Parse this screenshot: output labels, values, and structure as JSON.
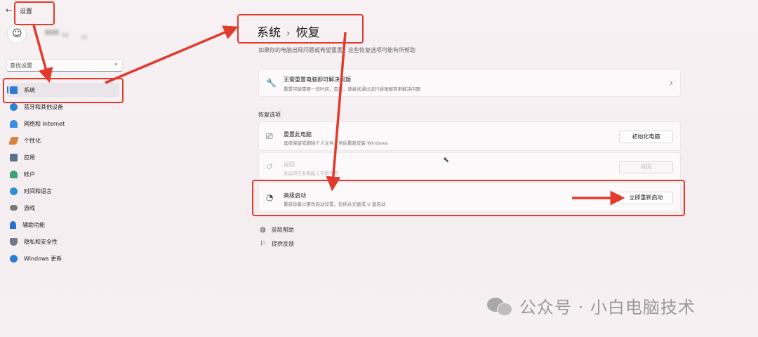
{
  "app": {
    "back_glyph": "←",
    "title": "设置"
  },
  "user": {
    "avatar": "smiley-avatar"
  },
  "search": {
    "placeholder": "查找设置",
    "icon": "search-icon"
  },
  "sidebar": {
    "items": [
      {
        "label": "系统",
        "icon": "display-icon",
        "color": "#2f7bd6",
        "active": true
      },
      {
        "label": "蓝牙和其他设备",
        "icon": "bluetooth-icon",
        "color": "#2c82d9"
      },
      {
        "label": "网络和 Internet",
        "icon": "wifi-icon",
        "color": "#3a8ee6"
      },
      {
        "label": "个性化",
        "icon": "brush-icon",
        "color": "#d9823a"
      },
      {
        "label": "应用",
        "icon": "apps-icon",
        "color": "#5a6f8a"
      },
      {
        "label": "帐户",
        "icon": "account-icon",
        "color": "#3aa37a"
      },
      {
        "label": "时间和语言",
        "icon": "globe-clock-icon",
        "color": "#2e8fd0"
      },
      {
        "label": "游戏",
        "icon": "gamepad-icon",
        "color": "#7a7a7a"
      },
      {
        "label": "辅助功能",
        "icon": "accessibility-icon",
        "color": "#2b6fd0"
      },
      {
        "label": "隐私和安全性",
        "icon": "shield-icon",
        "color": "#6d7b8c"
      },
      {
        "label": "Windows 更新",
        "icon": "update-icon",
        "color": "#2a7fd4"
      }
    ]
  },
  "breadcrumb": {
    "parent": "系统",
    "separator": "›",
    "current": "恢复"
  },
  "description": "如果你的电脑出现问题或希望重置，这些恢复选项可能有所帮助",
  "troubleshoot": {
    "title": "无需重置电脑即可解决问题",
    "subtitle": "重置可能需要一段时间，首先，请尝试通过运行疑难解答来解决问题",
    "icon": "wrench-icon",
    "chevron": "›"
  },
  "recovery_options": {
    "heading": "恢复选项",
    "items": [
      {
        "title": "重置此电脑",
        "subtitle": "选择保留或删除个人文件，然后重新安装 Windows",
        "button": "初始化电脑",
        "icon": "reset-pc-icon",
        "disabled": false
      },
      {
        "title": "返回",
        "subtitle": "此选项在此电脑上不再可用",
        "button": "返回",
        "icon": "history-icon",
        "disabled": true
      },
      {
        "title": "高级启动",
        "subtitle": "重启设备以更改启动设置，包括从光盘或 U 盘启动",
        "button": "立即重新启动",
        "icon": "advanced-startup-icon",
        "disabled": false
      }
    ]
  },
  "links": [
    {
      "label": "获取帮助",
      "icon": "help-icon"
    },
    {
      "label": "提供反馈",
      "icon": "feedback-icon"
    }
  ],
  "watermark": {
    "text": "公众号 · 小白电脑技术",
    "icon": "wechat-icon"
  },
  "annotation_color": "#e03b2c"
}
